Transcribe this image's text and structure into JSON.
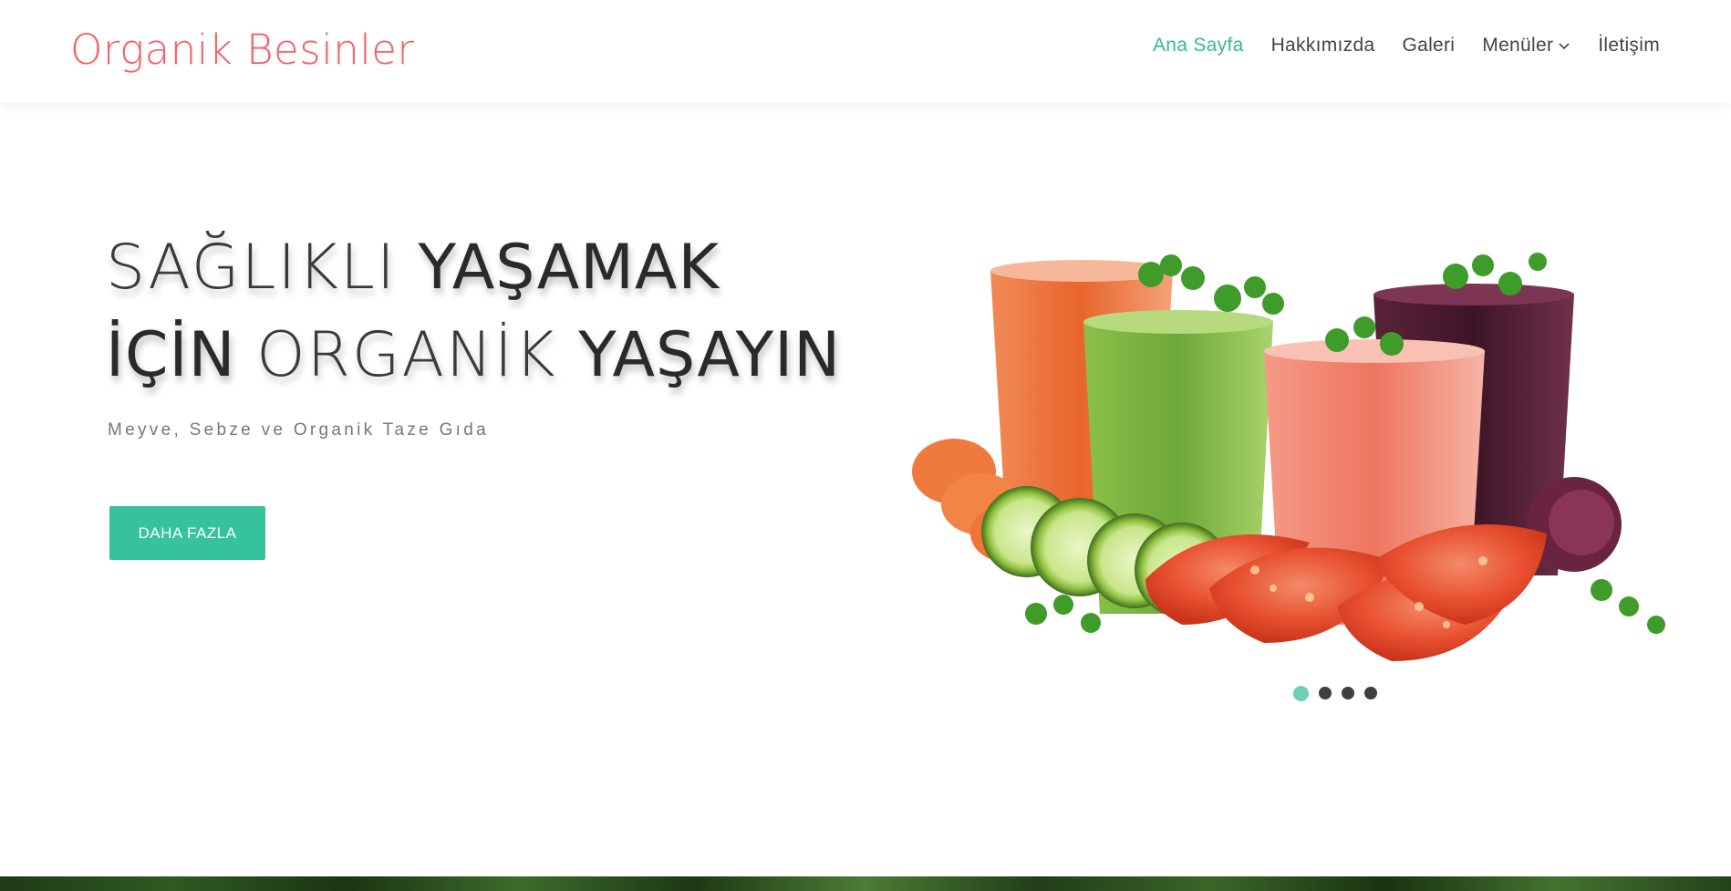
{
  "header": {
    "logo": "Organik Besinler",
    "nav": [
      {
        "label": "Ana Sayfa",
        "active": true
      },
      {
        "label": "Hakkımızda",
        "active": false
      },
      {
        "label": "Galeri",
        "active": false
      },
      {
        "label": "Menüler",
        "active": false,
        "dropdown": true
      },
      {
        "label": "İletişim",
        "active": false
      }
    ]
  },
  "hero": {
    "title_line1_thin": "SAĞLIKLI ",
    "title_line1_bold": "YAŞAMAK",
    "title_line2_bold_a": "İÇİN ",
    "title_line2_thin": "ORGANİK ",
    "title_line2_bold_b": "YAŞAYIN",
    "subtitle": "Meyve, Sebze ve Organik Taze Gıda",
    "button_label": "DAHA FAZLA",
    "slider": {
      "total": 4,
      "active_index": 0
    }
  },
  "colors": {
    "brand": "#f0626a",
    "accent": "#35c29c",
    "nav_active": "#38b794",
    "dot_active": "#6ccfb9",
    "dot": "#3f3f3f"
  }
}
